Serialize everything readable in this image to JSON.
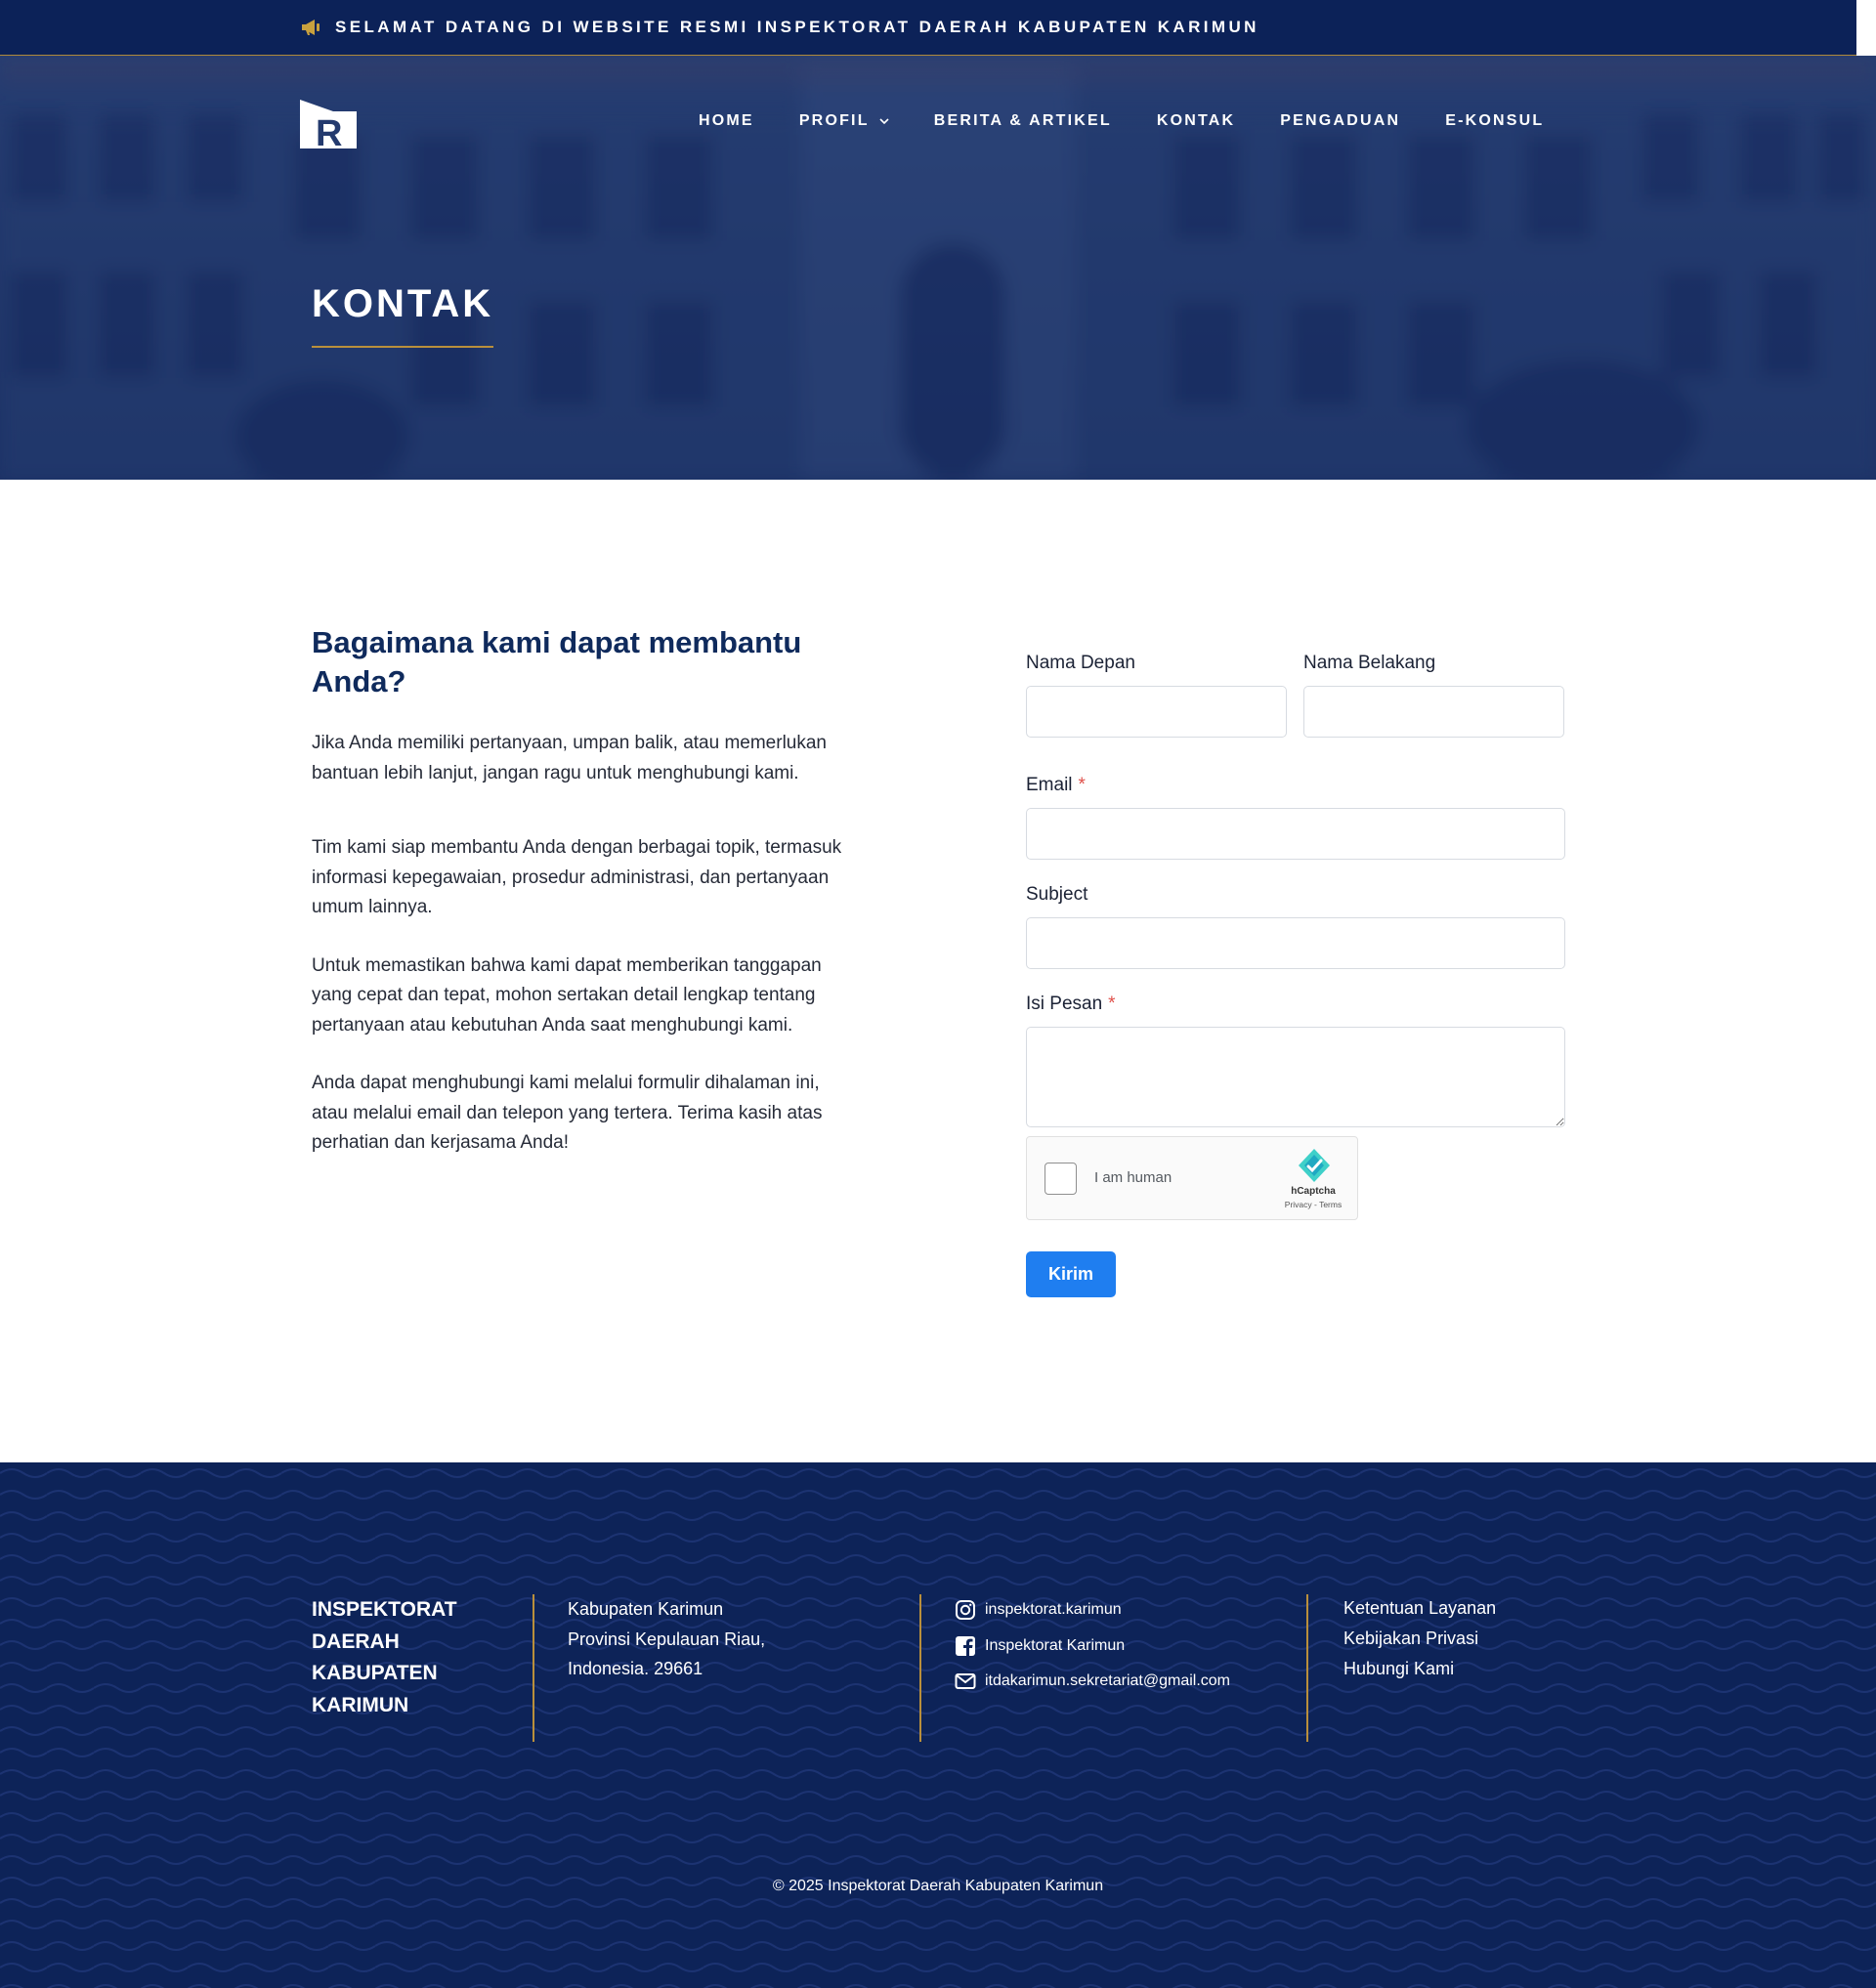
{
  "topbar": {
    "announcement": "SELAMAT DATANG DI WEBSITE RESMI INSPEKTORAT DAERAH KABUPATEN KARIMUN",
    "icon": "megaphone-icon"
  },
  "header": {
    "logo_letter": "R",
    "nav": [
      {
        "label": "HOME"
      },
      {
        "label": "PROFIL",
        "has_dropdown": true
      },
      {
        "label": "BERITA & ARTIKEL"
      },
      {
        "label": "KONTAK"
      },
      {
        "label": "PENGADUAN"
      },
      {
        "label": "E-KONSUL"
      }
    ]
  },
  "hero": {
    "title": "KONTAK"
  },
  "intro": {
    "heading": "Bagaimana kami dapat membantu Anda?",
    "paragraphs": [
      "Jika Anda memiliki pertanyaan, umpan balik, atau memerlukan bantuan lebih lanjut, jangan ragu untuk menghubungi kami.",
      "Tim kami siap membantu Anda dengan berbagai topik, termasuk informasi kepegawaian, prosedur administrasi, dan pertanyaan umum lainnya.",
      "Untuk memastikan bahwa kami dapat memberikan tanggapan yang cepat dan tepat, mohon sertakan detail lengkap tentang pertanyaan atau kebutuhan Anda saat menghubungi kami.",
      "Anda dapat menghubungi kami melalui formulir dihalaman ini, atau melalui email dan telepon yang tertera. Terima kasih atas perhatian dan kerjasama Anda!"
    ]
  },
  "form": {
    "first_name": {
      "label": "Nama Depan",
      "value": ""
    },
    "last_name": {
      "label": "Nama Belakang",
      "value": ""
    },
    "email": {
      "label": "Email",
      "required_mark": "*",
      "value": ""
    },
    "subject": {
      "label": "Subject",
      "value": ""
    },
    "message": {
      "label": "Isi Pesan",
      "required_mark": "*",
      "value": ""
    },
    "captcha": {
      "label": "I am human",
      "brand": "hCaptcha",
      "links": "Privacy - Terms"
    },
    "submit_label": "Kirim"
  },
  "footer": {
    "org_name": "INSPEKTORAT DAERAH KABUPATEN KARIMUN",
    "address": [
      "Kabupaten Karimun",
      "Provinsi Kepulauan Riau,",
      "Indonesia. 29661"
    ],
    "social": [
      {
        "icon": "instagram-icon",
        "label": "inspektorat.karimun"
      },
      {
        "icon": "facebook-icon",
        "label": "Inspektorat Karimun"
      },
      {
        "icon": "envelope-icon",
        "label": "itdakarimun.sekretariat@gmail.com"
      }
    ],
    "links": [
      "Ketentuan Layanan",
      "Kebijakan Privasi",
      "Hubungi Kami"
    ],
    "copyright": "© 2025 Inspektorat Daerah Kabupaten Karimun"
  },
  "colors": {
    "navy": "#0c2258",
    "gold": "#b98f3c",
    "button_blue": "#1f7ef0",
    "required_red": "#e0504a",
    "heading_navy": "#0f2a5c"
  }
}
